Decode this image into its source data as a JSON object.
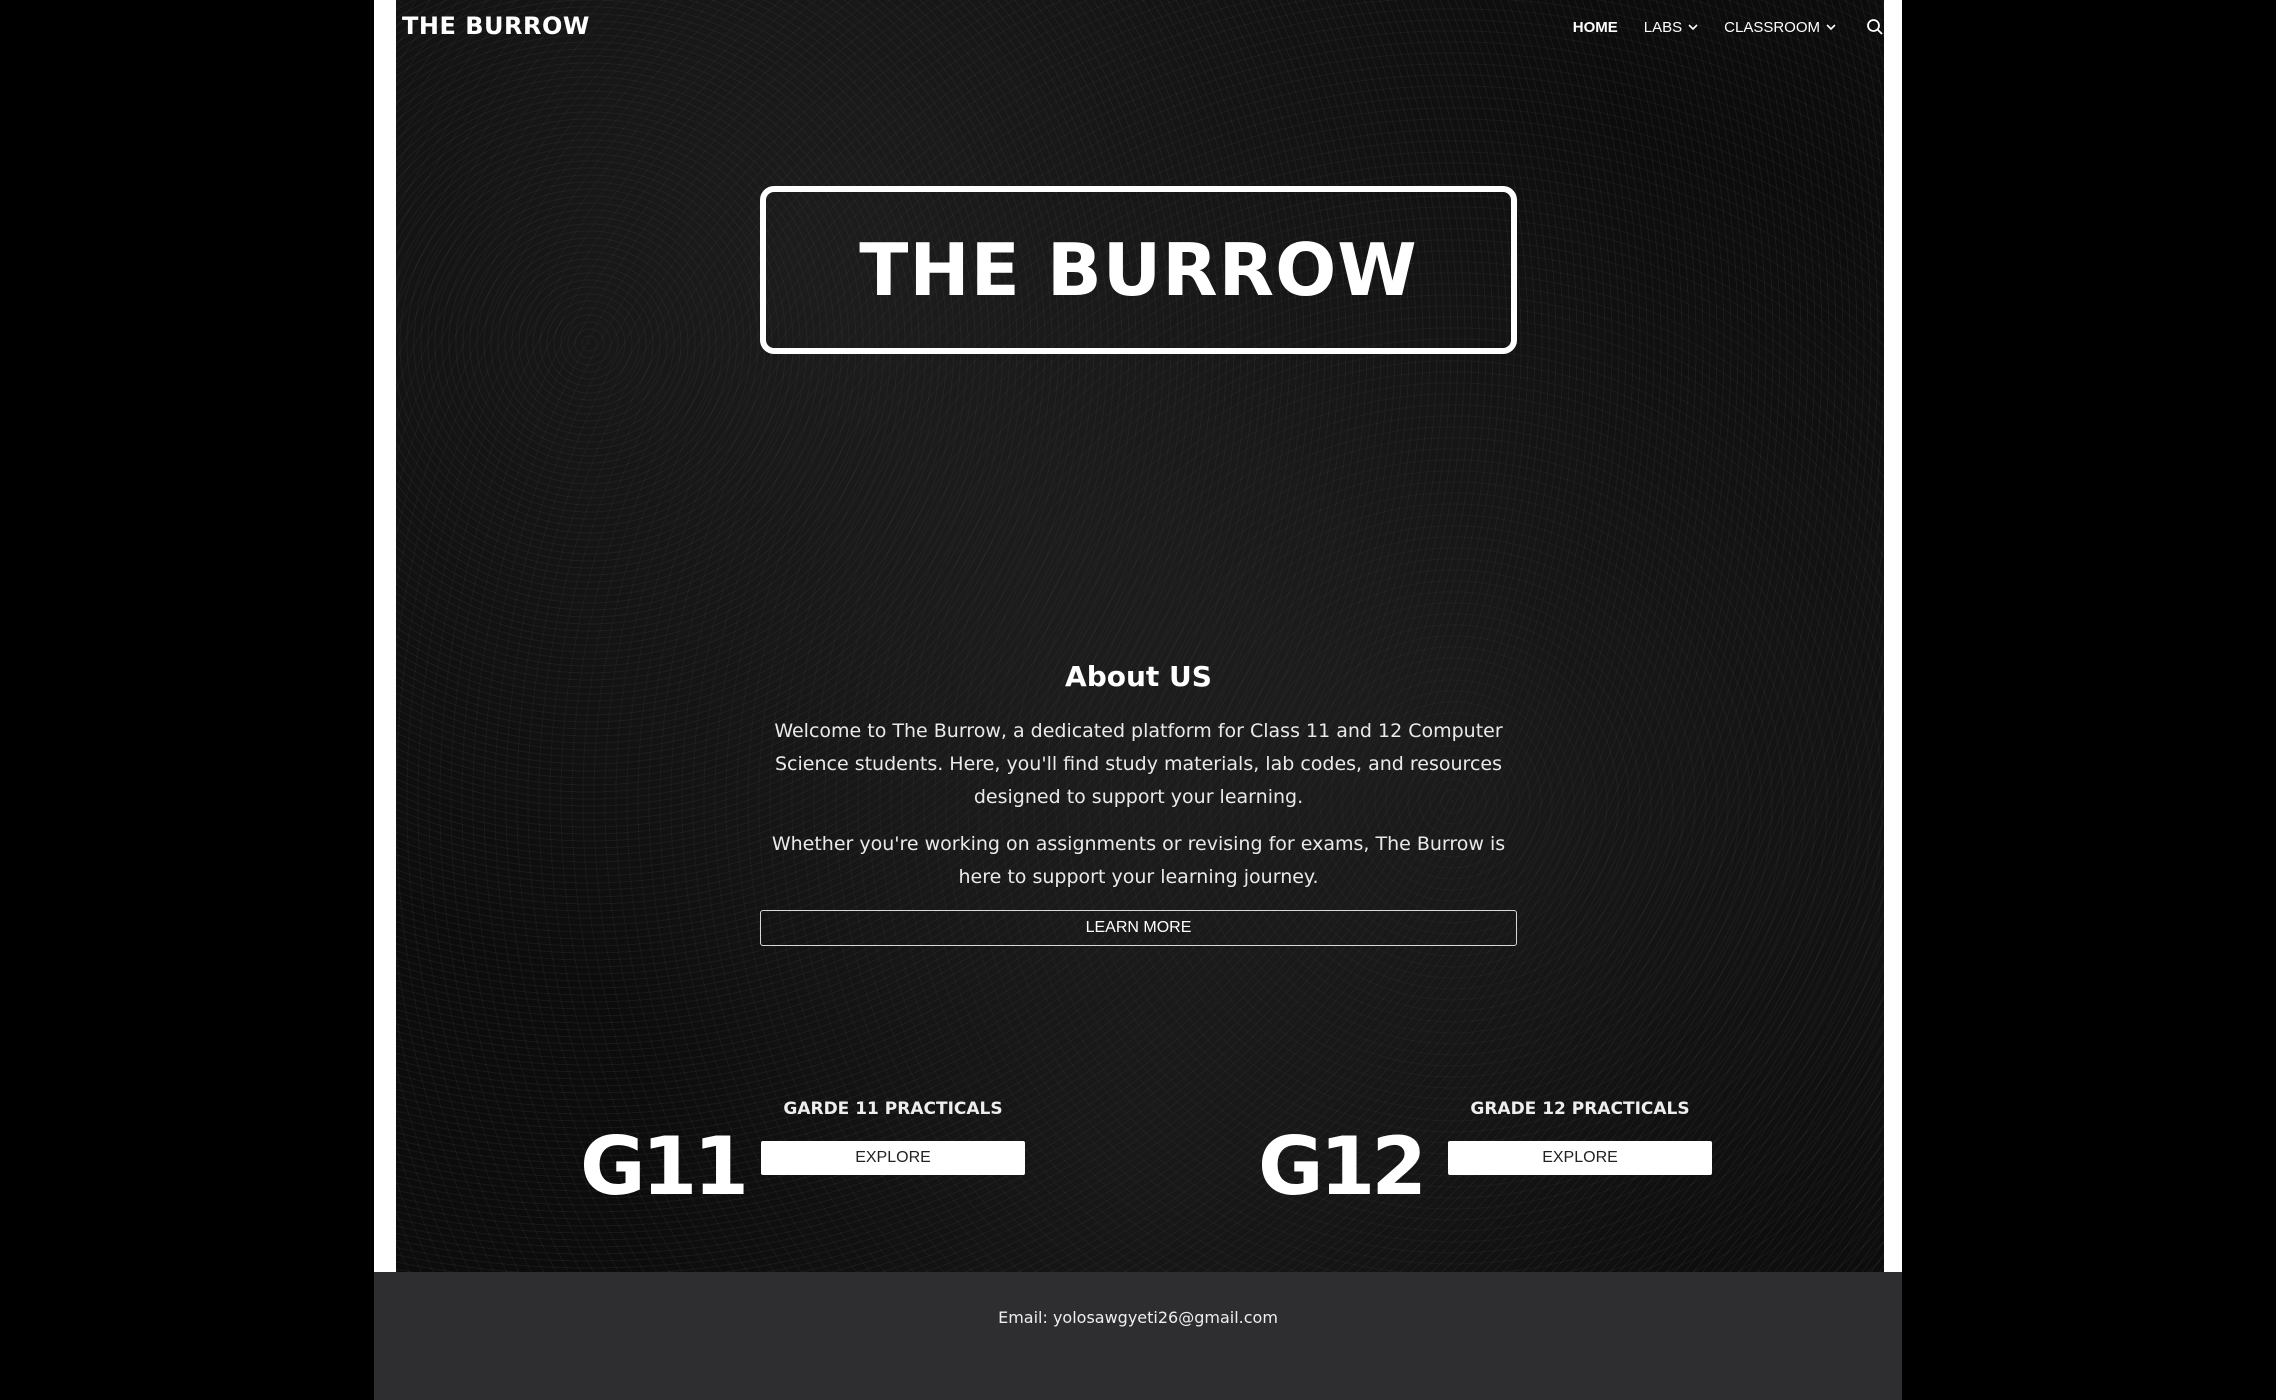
{
  "header": {
    "logo": "THE BURROW",
    "nav": [
      {
        "label": "HOME"
      },
      {
        "label": "LABS"
      },
      {
        "label": "CLASSROOM"
      }
    ]
  },
  "hero": {
    "title": "THE BURROW"
  },
  "about": {
    "heading": "About US",
    "paragraph1": "Welcome to The Burrow, a dedicated platform for Class 11 and 12 Computer Science students. Here, you'll find study materials, lab codes, and resources designed to support your learning.",
    "paragraph2": "Whether you're working on assignments or revising for exams, The Burrow is here to support your learning journey.",
    "button_label": "LEARN MORE"
  },
  "grades": [
    {
      "badge": "G11",
      "title": "GARDE 11 PRACTICALS",
      "button_label": "EXPLORE"
    },
    {
      "badge": "G12",
      "title": "GRADE 12 PRACTICALS",
      "button_label": "EXPLORE"
    }
  ],
  "footer": {
    "email": "Email: yolosawgyeti26@gmail.com"
  }
}
